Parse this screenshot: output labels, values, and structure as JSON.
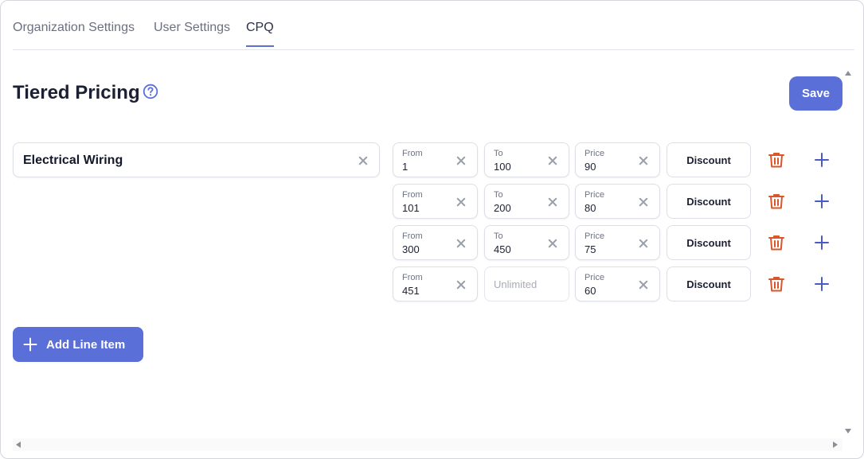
{
  "tabs": [
    {
      "label": "Organization Settings",
      "active": false
    },
    {
      "label": "User Settings",
      "active": false
    },
    {
      "label": "CPQ",
      "active": true
    }
  ],
  "page": {
    "title": "Tiered Pricing",
    "help_icon": "question-circle-icon",
    "save_label": "Save"
  },
  "line_item": {
    "name": "Electrical Wiring"
  },
  "tiers": [
    {
      "from_label": "From",
      "from": "1",
      "to_label": "To",
      "to": "100",
      "price_label": "Price",
      "price": "90",
      "discount_label": "Discount"
    },
    {
      "from_label": "From",
      "from": "101",
      "to_label": "To",
      "to": "200",
      "price_label": "Price",
      "price": "80",
      "discount_label": "Discount"
    },
    {
      "from_label": "From",
      "from": "300",
      "to_label": "To",
      "to": "450",
      "price_label": "Price",
      "price": "75",
      "discount_label": "Discount"
    },
    {
      "from_label": "From",
      "from": "451",
      "to_placeholder": "Unlimited",
      "price_label": "Price",
      "price": "60",
      "discount_label": "Discount"
    }
  ],
  "actions": {
    "add_line_item_label": "Add Line Item",
    "delete_icon": "trash-icon",
    "add_tier_icon": "plus-icon"
  },
  "colors": {
    "accent": "#5b6fd8",
    "danger": "#d9562b",
    "add_icon": "#4a5cc4"
  }
}
